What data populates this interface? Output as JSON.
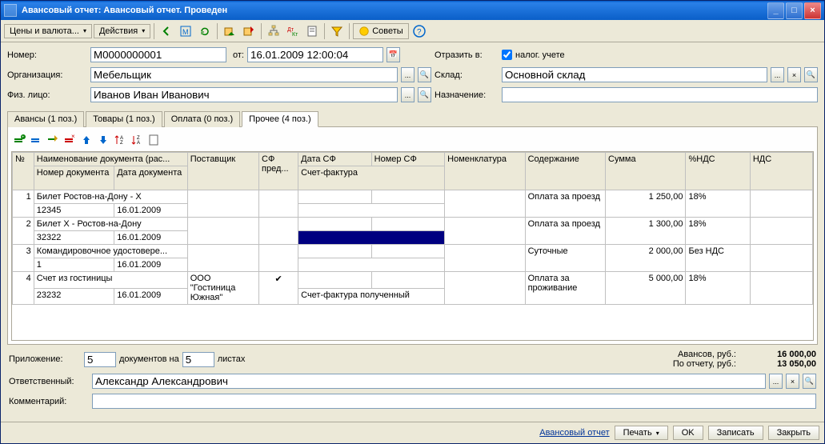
{
  "window": {
    "title": "Авансовый отчет: Авансовый отчет. Проведен"
  },
  "toolbar": {
    "prices": "Цены и валюта...",
    "actions": "Действия",
    "tips": "Советы"
  },
  "header": {
    "number_label": "Номер:",
    "number": "М0000000001",
    "from_label": "от:",
    "date": "16.01.2009 12:00:04",
    "reflect_label": "Отразить в:",
    "reflect_chk": "налог. учете",
    "org_label": "Организация:",
    "org": "Мебельщик",
    "sklad_label": "Склад:",
    "sklad": "Основной склад",
    "fiz_label": "Физ. лицо:",
    "fiz": "Иванов Иван Иванович",
    "nazn_label": "Назначение:",
    "nazn": ""
  },
  "tabs": [
    "Авансы (1 поз.)",
    "Товары (1 поз.)",
    "Оплата (0 поз.)",
    "Прочее (4 поз.)"
  ],
  "grid": {
    "cols": [
      "№",
      "Наименование документа (рас...",
      "Поставщик",
      "СФ пред...",
      "Дата СФ",
      "Номер СФ",
      "Номенклатура",
      "Содержание",
      "Сумма",
      "%НДС",
      "НДС"
    ],
    "sub1": "Номер документа",
    "sub2": "Дата документа",
    "sub3": "Счет-фактура",
    "rows": [
      {
        "n": "1",
        "name": "Билет Ростов-на-Дону - Х",
        "docnum": "12345",
        "docdate": "16.01.2009",
        "post": "",
        "sfp": "",
        "sfdate": "",
        "sfnum": "",
        "nom": "",
        "cont": "Оплата за проезд",
        "sum": "1 250,00",
        "nds": "18%",
        "ndsv": ""
      },
      {
        "n": "2",
        "name": "Билет Х - Ростов-на-Дону",
        "docnum": "32322",
        "docdate": "16.01.2009",
        "post": "",
        "sfp": "",
        "sfdate": "",
        "sfnum": "",
        "nom": "",
        "cont": "Оплата за проезд",
        "sum": "1 300,00",
        "nds": "18%",
        "ndsv": "",
        "selected": true
      },
      {
        "n": "3",
        "name": "Командировочное удостовере...",
        "docnum": "1",
        "docdate": "16.01.2009",
        "post": "",
        "sfp": "",
        "sfdate": "",
        "sfnum": "",
        "nom": "",
        "cont": "Суточные",
        "sum": "2 000,00",
        "nds": "Без НДС",
        "ndsv": ""
      },
      {
        "n": "4",
        "name": "Счет из гостиницы",
        "docnum": "23232",
        "docdate": "16.01.2009",
        "post": "ООО \"Гостиница Южная\"",
        "sfp": "✔",
        "sfdate": "",
        "sfnum": "",
        "sf_text": "Счет-фактура полученный",
        "nom": "",
        "cont": "Оплата за проживание",
        "sum": "5 000,00",
        "nds": "18%",
        "ndsv": ""
      }
    ]
  },
  "attach": {
    "label1": "Приложение:",
    "docs": "5",
    "label2": "документов на",
    "sheets": "5",
    "label3": "листах"
  },
  "totals": {
    "adv_label": "Авансов, руб.:",
    "adv": "16 000,00",
    "rep_label": "По отчету, руб.:",
    "rep": "13 050,00"
  },
  "footer": {
    "resp_label": "Ответственный:",
    "resp": "Александр Александрович",
    "comm_label": "Комментарий:",
    "comm": ""
  },
  "actions": {
    "report": "Авансовый отчет",
    "print": "Печать",
    "ok": "OK",
    "write": "Записать",
    "close": "Закрыть"
  }
}
